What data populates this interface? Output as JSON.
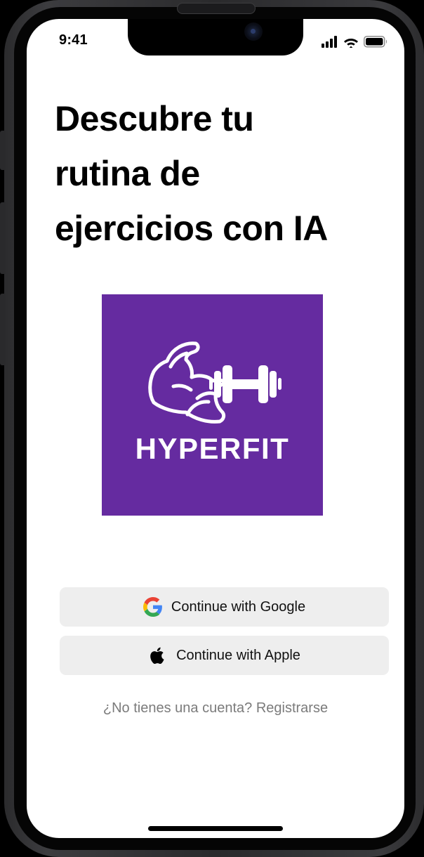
{
  "status_bar": {
    "time": "9:41",
    "icons": [
      "cellular-signal-icon",
      "wifi-icon",
      "battery-icon"
    ]
  },
  "onboarding": {
    "headline_lines": [
      "Descubre tu",
      "rutina de",
      "ejercicios con IA"
    ]
  },
  "logo": {
    "wordmark": "HYPERFIT",
    "background_color": "#652ba0",
    "icons": [
      "flexed-arm-icon",
      "dumbbell-icon"
    ]
  },
  "auth": {
    "google_label": "Continue with Google",
    "apple_label": "Continue with Apple",
    "button_background": "#eeeeee"
  },
  "signup": {
    "prompt": "¿No tienes una cuenta?",
    "link_label": "Registrarse"
  }
}
